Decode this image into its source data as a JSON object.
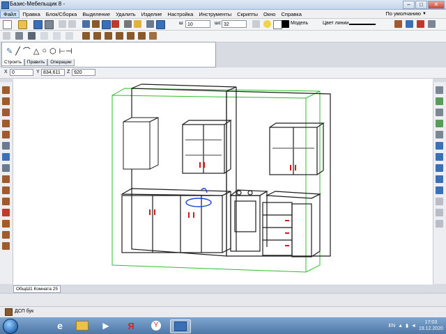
{
  "window": {
    "title": "Базис-Мебельщик 8 -",
    "minimize": "–",
    "maximize": "□",
    "close": "✕"
  },
  "menu": {
    "items": [
      "Файл",
      "Правка",
      "Блок/Сборка",
      "Выделение",
      "Удалить",
      "Изделие",
      "Настройка",
      "Инструменты",
      "Скрипты",
      "Окно",
      "Справка"
    ],
    "view_label": "По умолчанию"
  },
  "toolbar": {
    "line_width": "10",
    "grid_step_label": "шс",
    "grid_step": "32",
    "color_mode": "Модель",
    "line_color_label": "Цвет линии"
  },
  "panel": {
    "tabs": [
      "Строить",
      "Править",
      "Операции"
    ],
    "active_tab": 0
  },
  "coords": {
    "x_label": "X",
    "x": "0",
    "y_label": "Y",
    "y": "834,611",
    "z_label": "Z",
    "z": "920"
  },
  "document": {
    "tab_label": "ОбщШ1 Комната 25"
  },
  "status": {
    "material": "ДСП бук"
  },
  "taskbar": {
    "lang": "EN",
    "time": "17:03",
    "date": "19.12.2020"
  },
  "icons": {
    "colors": {
      "accent": "#3b6fb6",
      "frame": "#1b1b1b",
      "bbox": "#2bbf2b",
      "handle": "#d11a1a",
      "sink": "#1a3fd6"
    }
  }
}
